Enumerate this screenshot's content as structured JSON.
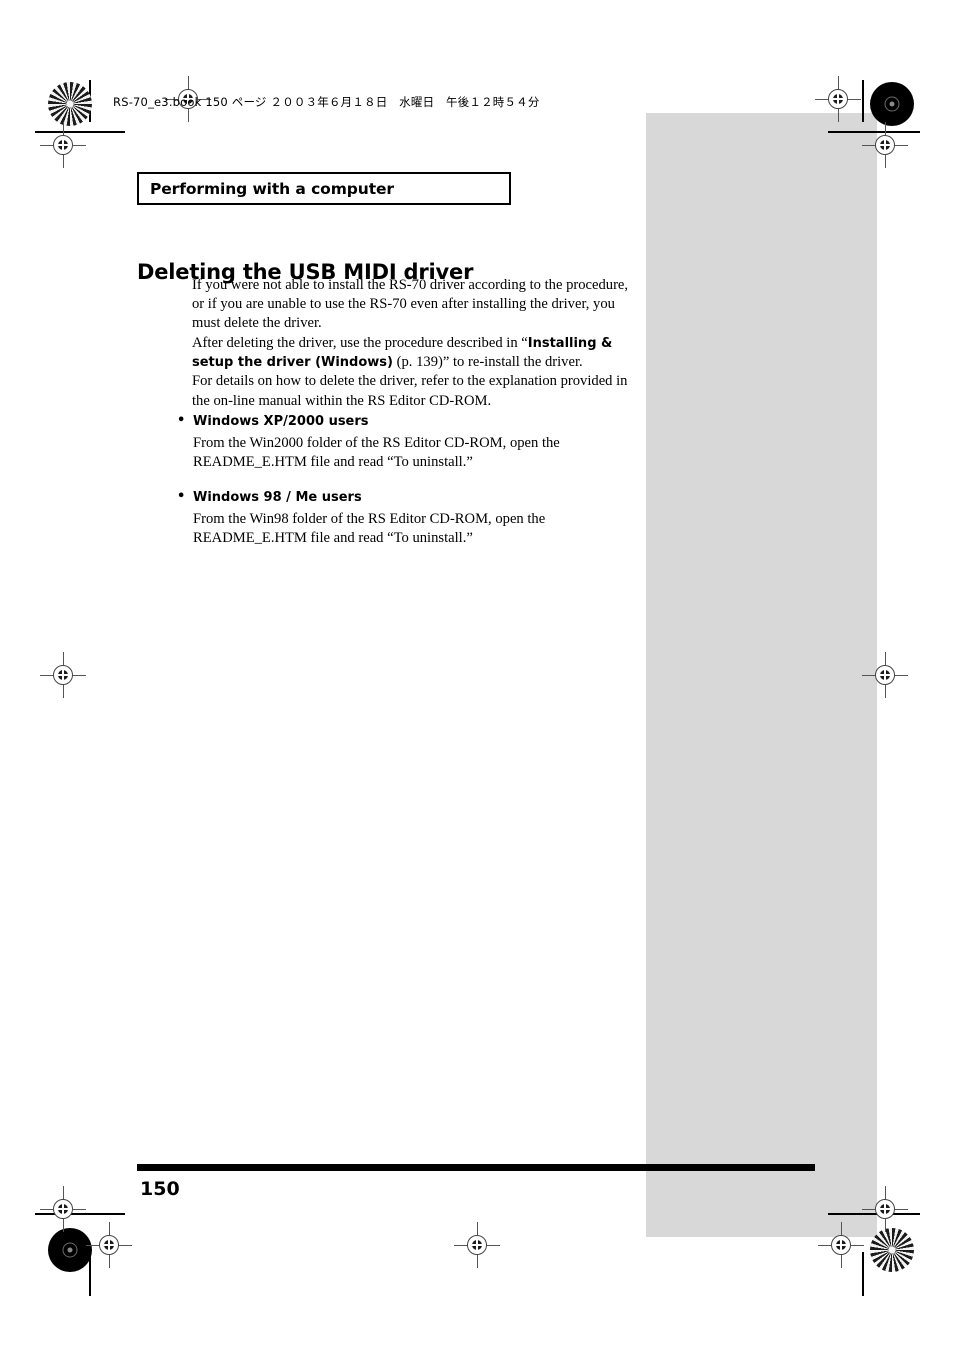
{
  "print_slug": {
    "text": "RS-70_e3.book  150 ページ  ２００３年６月１８日　水曜日　午後１２時５４分"
  },
  "chapter": {
    "title": "Performing with a computer"
  },
  "section": {
    "title": "Deleting the USB MIDI driver"
  },
  "body": {
    "paragraph_1": "If you were not able to install the RS-70 driver according to the procedure, or if you are unable to use the RS-70 even after installing the driver, you must delete the driver.",
    "paragraph_2_lead": "After deleting the driver, use the procedure described in “",
    "paragraph_2_bold": "Installing & setup the driver (Windows)",
    "paragraph_2_tail": " (p. 139)” to re-install the driver.",
    "paragraph_3": "For details on how to delete the driver, refer to the explanation provided in the on-line manual within the RS Editor CD-ROM."
  },
  "bullets": [
    {
      "heading": "Windows XP/2000 users",
      "text": "From the Win2000 folder of the RS Editor CD-ROM, open the README_E.HTM file and read “To uninstall.”"
    },
    {
      "heading": "Windows 98 / Me users",
      "text": "From the Win98 folder of the RS Editor CD-ROM, open the README_E.HTM file and read “To uninstall.”"
    }
  ],
  "footer": {
    "page_number": "150"
  },
  "colors": {
    "ink": "#000000",
    "gray_panel": "#d8d8d8",
    "registration_line": "#555555"
  }
}
